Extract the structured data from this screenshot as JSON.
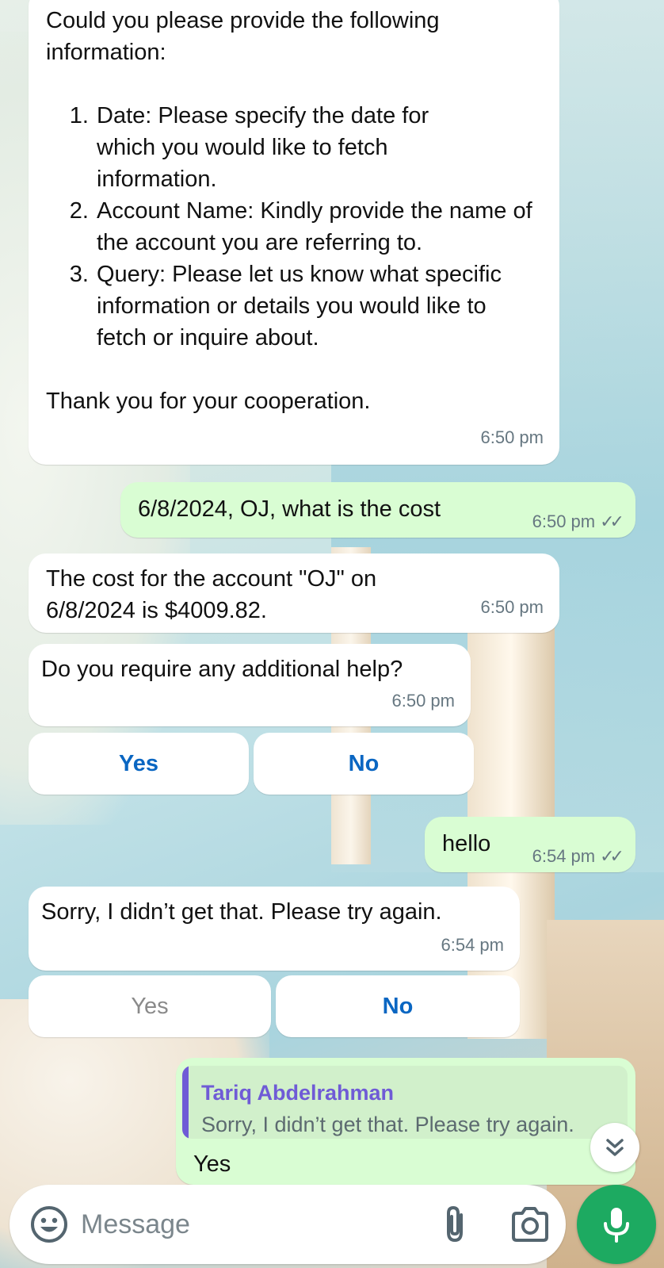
{
  "messages": {
    "m1": {
      "intro": "Could you please provide the following information:",
      "items": [
        "Date: Please specify the date for which you would like to fetch information.",
        "Account Name: Kindly provide the name of the account you are referring to.",
        "Query: Please let us know what specific information or details you would like to fetch or inquire about."
      ],
      "outro": "Thank you for your cooperation.",
      "time": "6:50 pm"
    },
    "m2": {
      "text": "6/8/2024, OJ, what is the cost",
      "time": "6:50 pm",
      "status": "read"
    },
    "m3": {
      "text": "The cost for the account \"OJ\" on 6/8/2024 is $4009.82.",
      "time": "6:50 pm"
    },
    "m4": {
      "text": "Do you require any additional help?",
      "time": "6:50 pm",
      "buttons": [
        "Yes",
        "No"
      ]
    },
    "m5": {
      "text": "hello",
      "time": "6:54 pm",
      "status": "read"
    },
    "m6": {
      "text": "Sorry, I didn’t get that. Please try again.",
      "time": "6:54 pm",
      "buttons": [
        "Yes",
        "No"
      ]
    },
    "m7": {
      "reply_name": "Tariq Abdelrahman",
      "reply_text": "Sorry, I didn’t get that. Please try again.",
      "text": "Yes"
    }
  },
  "composer": {
    "placeholder": "Message"
  },
  "icons": {
    "emoji": "emoji-icon",
    "attach": "paperclip-icon",
    "camera": "camera-icon",
    "mic": "microphone-icon",
    "scroll": "double-chevron-down-icon",
    "read": "double-check-icon"
  },
  "colors": {
    "incoming_bubble": "#ffffff",
    "outgoing_bubble": "#d9fdd3",
    "quick_reply_text": "#0a66c2",
    "reply_accent": "#6f5bd6",
    "mic_button": "#1daa61",
    "timestamp": "#667781"
  }
}
